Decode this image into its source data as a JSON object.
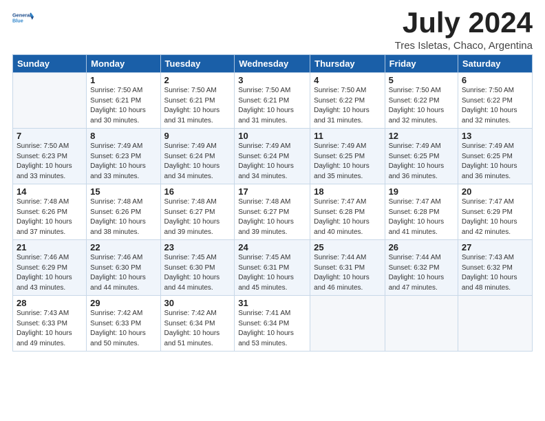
{
  "logo": {
    "line1": "General",
    "line2": "Blue"
  },
  "title": "July 2024",
  "subtitle": "Tres Isletas, Chaco, Argentina",
  "weekdays": [
    "Sunday",
    "Monday",
    "Tuesday",
    "Wednesday",
    "Thursday",
    "Friday",
    "Saturday"
  ],
  "weeks": [
    [
      {
        "day": "",
        "info": ""
      },
      {
        "day": "1",
        "info": "Sunrise: 7:50 AM\nSunset: 6:21 PM\nDaylight: 10 hours\nand 30 minutes."
      },
      {
        "day": "2",
        "info": "Sunrise: 7:50 AM\nSunset: 6:21 PM\nDaylight: 10 hours\nand 31 minutes."
      },
      {
        "day": "3",
        "info": "Sunrise: 7:50 AM\nSunset: 6:21 PM\nDaylight: 10 hours\nand 31 minutes."
      },
      {
        "day": "4",
        "info": "Sunrise: 7:50 AM\nSunset: 6:22 PM\nDaylight: 10 hours\nand 31 minutes."
      },
      {
        "day": "5",
        "info": "Sunrise: 7:50 AM\nSunset: 6:22 PM\nDaylight: 10 hours\nand 32 minutes."
      },
      {
        "day": "6",
        "info": "Sunrise: 7:50 AM\nSunset: 6:22 PM\nDaylight: 10 hours\nand 32 minutes."
      }
    ],
    [
      {
        "day": "7",
        "info": "Sunrise: 7:50 AM\nSunset: 6:23 PM\nDaylight: 10 hours\nand 33 minutes."
      },
      {
        "day": "8",
        "info": "Sunrise: 7:49 AM\nSunset: 6:23 PM\nDaylight: 10 hours\nand 33 minutes."
      },
      {
        "day": "9",
        "info": "Sunrise: 7:49 AM\nSunset: 6:24 PM\nDaylight: 10 hours\nand 34 minutes."
      },
      {
        "day": "10",
        "info": "Sunrise: 7:49 AM\nSunset: 6:24 PM\nDaylight: 10 hours\nand 34 minutes."
      },
      {
        "day": "11",
        "info": "Sunrise: 7:49 AM\nSunset: 6:25 PM\nDaylight: 10 hours\nand 35 minutes."
      },
      {
        "day": "12",
        "info": "Sunrise: 7:49 AM\nSunset: 6:25 PM\nDaylight: 10 hours\nand 36 minutes."
      },
      {
        "day": "13",
        "info": "Sunrise: 7:49 AM\nSunset: 6:25 PM\nDaylight: 10 hours\nand 36 minutes."
      }
    ],
    [
      {
        "day": "14",
        "info": "Sunrise: 7:48 AM\nSunset: 6:26 PM\nDaylight: 10 hours\nand 37 minutes."
      },
      {
        "day": "15",
        "info": "Sunrise: 7:48 AM\nSunset: 6:26 PM\nDaylight: 10 hours\nand 38 minutes."
      },
      {
        "day": "16",
        "info": "Sunrise: 7:48 AM\nSunset: 6:27 PM\nDaylight: 10 hours\nand 39 minutes."
      },
      {
        "day": "17",
        "info": "Sunrise: 7:48 AM\nSunset: 6:27 PM\nDaylight: 10 hours\nand 39 minutes."
      },
      {
        "day": "18",
        "info": "Sunrise: 7:47 AM\nSunset: 6:28 PM\nDaylight: 10 hours\nand 40 minutes."
      },
      {
        "day": "19",
        "info": "Sunrise: 7:47 AM\nSunset: 6:28 PM\nDaylight: 10 hours\nand 41 minutes."
      },
      {
        "day": "20",
        "info": "Sunrise: 7:47 AM\nSunset: 6:29 PM\nDaylight: 10 hours\nand 42 minutes."
      }
    ],
    [
      {
        "day": "21",
        "info": "Sunrise: 7:46 AM\nSunset: 6:29 PM\nDaylight: 10 hours\nand 43 minutes."
      },
      {
        "day": "22",
        "info": "Sunrise: 7:46 AM\nSunset: 6:30 PM\nDaylight: 10 hours\nand 44 minutes."
      },
      {
        "day": "23",
        "info": "Sunrise: 7:45 AM\nSunset: 6:30 PM\nDaylight: 10 hours\nand 44 minutes."
      },
      {
        "day": "24",
        "info": "Sunrise: 7:45 AM\nSunset: 6:31 PM\nDaylight: 10 hours\nand 45 minutes."
      },
      {
        "day": "25",
        "info": "Sunrise: 7:44 AM\nSunset: 6:31 PM\nDaylight: 10 hours\nand 46 minutes."
      },
      {
        "day": "26",
        "info": "Sunrise: 7:44 AM\nSunset: 6:32 PM\nDaylight: 10 hours\nand 47 minutes."
      },
      {
        "day": "27",
        "info": "Sunrise: 7:43 AM\nSunset: 6:32 PM\nDaylight: 10 hours\nand 48 minutes."
      }
    ],
    [
      {
        "day": "28",
        "info": "Sunrise: 7:43 AM\nSunset: 6:33 PM\nDaylight: 10 hours\nand 49 minutes."
      },
      {
        "day": "29",
        "info": "Sunrise: 7:42 AM\nSunset: 6:33 PM\nDaylight: 10 hours\nand 50 minutes."
      },
      {
        "day": "30",
        "info": "Sunrise: 7:42 AM\nSunset: 6:34 PM\nDaylight: 10 hours\nand 51 minutes."
      },
      {
        "day": "31",
        "info": "Sunrise: 7:41 AM\nSunset: 6:34 PM\nDaylight: 10 hours\nand 53 minutes."
      },
      {
        "day": "",
        "info": ""
      },
      {
        "day": "",
        "info": ""
      },
      {
        "day": "",
        "info": ""
      }
    ]
  ]
}
